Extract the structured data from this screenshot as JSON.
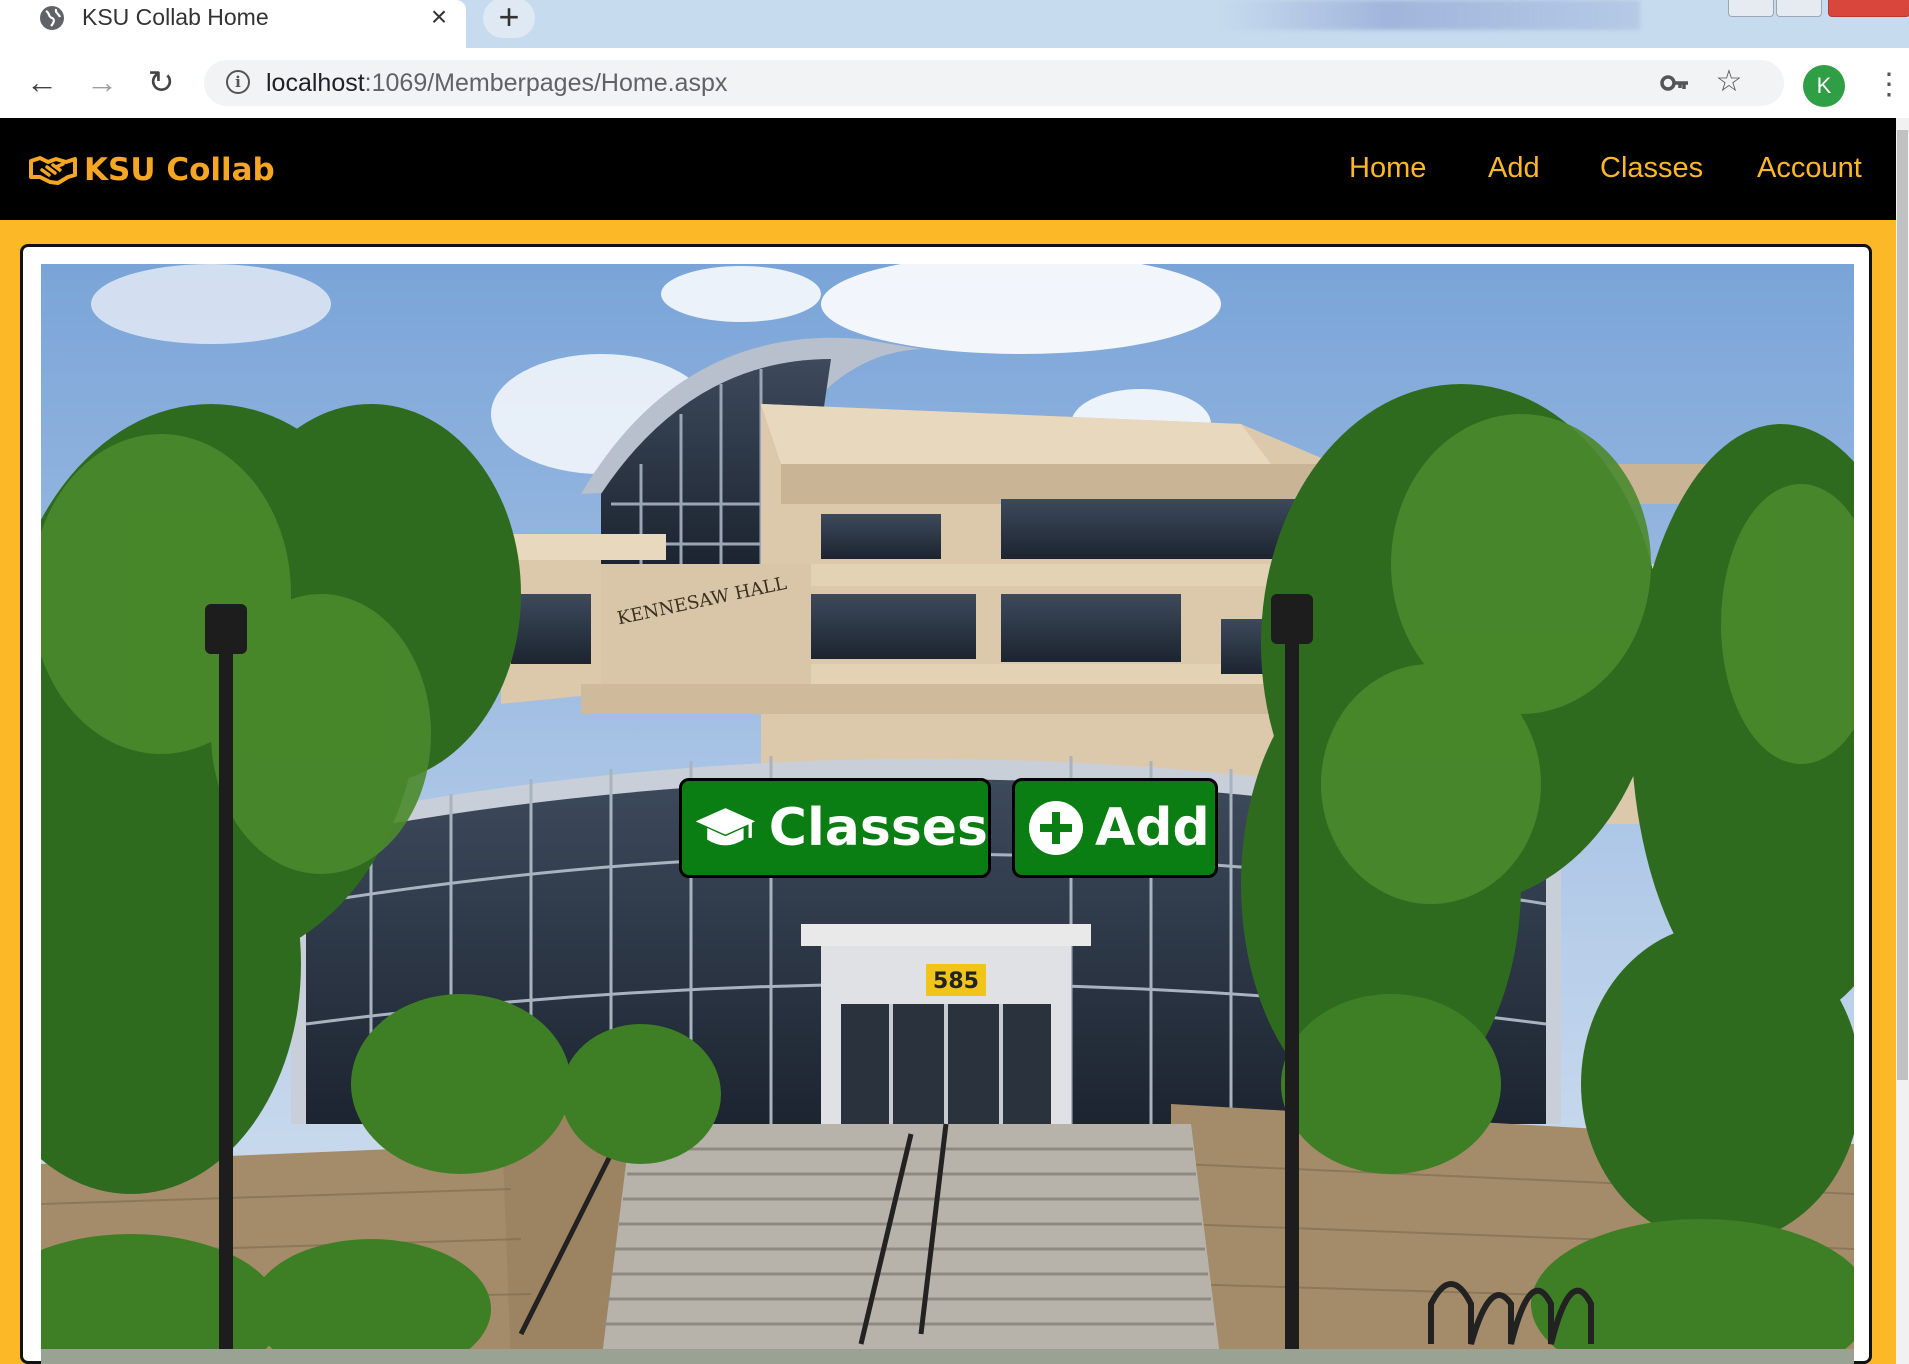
{
  "browser": {
    "tab_title": "KSU Collab Home",
    "tab_close": "×",
    "new_tab": "+",
    "url_host": "localhost",
    "url_rest": ":1069/Memberpages/Home.aspx",
    "avatar_letter": "K",
    "back": "←",
    "forward": "→",
    "reload": "↻",
    "star": "☆",
    "menu": "⋮",
    "info": "i"
  },
  "navbar": {
    "brand": "KSU Collab",
    "links": [
      "Home",
      "Add",
      "Classes",
      "Account"
    ]
  },
  "hero": {
    "building_sign": "KENNESAW HALL",
    "address_number": "585",
    "buttons": {
      "classes_label": "Classes",
      "add_label": "Add"
    }
  },
  "colors": {
    "brand_gold": "#fdb827",
    "navbar_bg": "#000000",
    "button_green": "#0a7d13"
  },
  "icons": {
    "brand": "handshake-icon",
    "classes_button": "graduation-cap-icon",
    "add_button": "plus-circle-icon"
  }
}
